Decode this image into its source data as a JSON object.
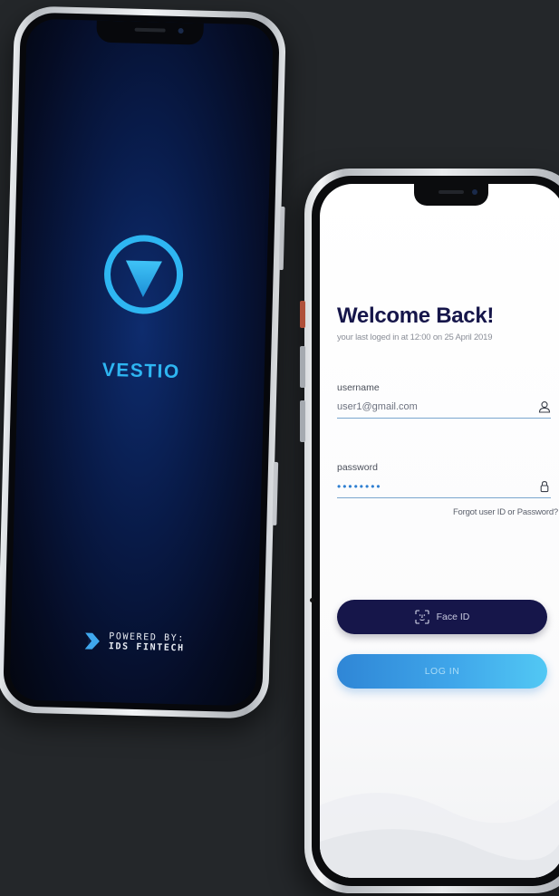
{
  "splash": {
    "brand_name": "VESTIO",
    "powered_by_line1": "POWERED BY:",
    "powered_by_line2": "IDS FINTECH",
    "icons": [
      "vestio-logo-icon",
      "ids-fintech-logo-icon"
    ],
    "colors": {
      "background": "#081a47",
      "brand": "#2eb6f2"
    }
  },
  "login": {
    "title": "Welcome Back!",
    "last_login": "your last loged in at 12:00 on 25 April 2019",
    "username": {
      "label": "username",
      "value": "user1@gmail.com",
      "icon": "user-icon"
    },
    "password": {
      "label": "password",
      "value": "••••••••",
      "icon": "lock-icon"
    },
    "forgot_link": "Forgot user ID or Password?",
    "face_id_button": {
      "label": "Face ID",
      "icon": "face-id-icon"
    },
    "login_button": {
      "label": "LOG IN"
    },
    "colors": {
      "title": "#16164a",
      "face_id_button": "#16164a",
      "login_gradient_start": "#2f86d6",
      "login_gradient_end": "#52c8f4",
      "field_underline": "#7aa6cf"
    }
  }
}
